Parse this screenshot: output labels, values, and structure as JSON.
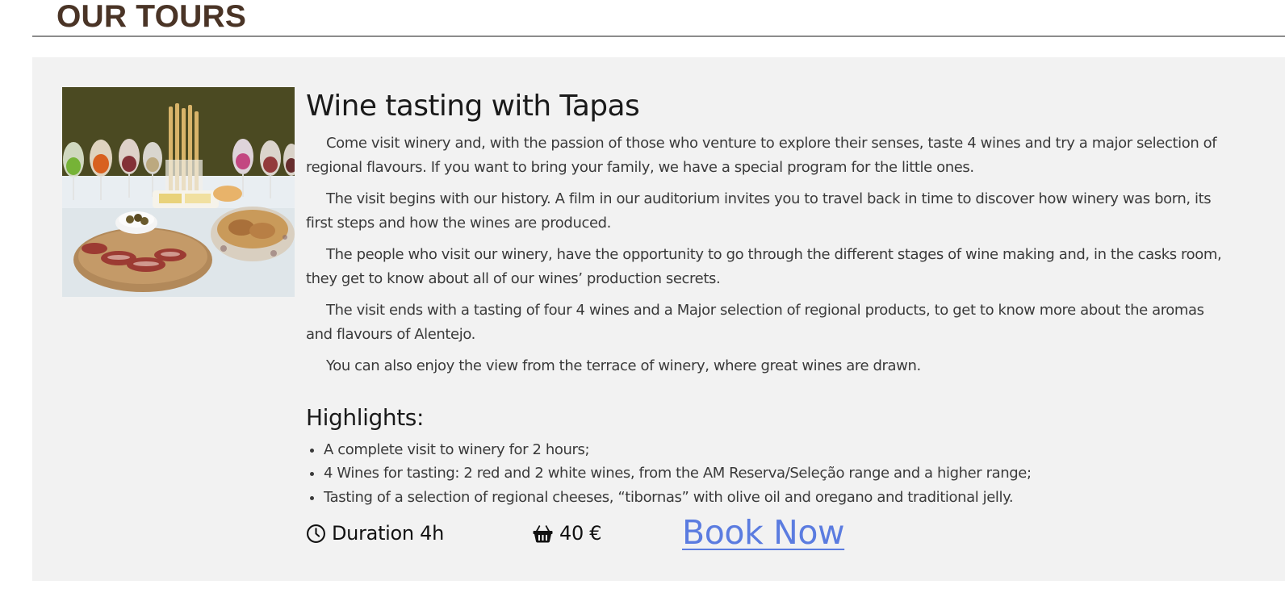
{
  "section": {
    "title": "OUR TOURS"
  },
  "tour": {
    "title": "Wine tasting with Tapas",
    "image_icon": "food-photo",
    "description": [
      "Come visit winery and, with the passion of those who venture to explore their senses, taste 4 wines and try a major selection of regional flavours. If you want to bring your family, we have a special program for the little ones.",
      "The visit begins with our history. A film in our auditorium invites you to travel back in time to discover how winery was born, its first steps and how the wines are produced.",
      "The people who visit our winery, have the opportunity to go through the different stages of wine making and, in the casks room, they get to know about all of our wines’ production secrets.",
      "The visit ends with a tasting of four 4 wines and a Major selection of regional products, to get to know more about the aromas and flavours of Alentejo.",
      "You can also enjoy the view from the terrace of winery, where great wines are drawn."
    ],
    "highlights_title": "Highlights:",
    "highlights": [
      "A complete visit to winery for 2 hours;",
      "4 Wines for tasting: 2 red and 2 white wines, from the AM Reserva/Seleção range and a higher range;",
      "Tasting of a selection of regional cheeses, “tibornas” with olive oil and oregano and traditional jelly."
    ],
    "duration_icon": "clock-icon",
    "duration": "Duration 4h",
    "price_icon": "basket-icon",
    "price": "40 €",
    "book_label": "Book Now"
  },
  "colors": {
    "heading": "#4a3426",
    "card_bg": "#f2f2f2",
    "link": "#5b7ce0"
  }
}
